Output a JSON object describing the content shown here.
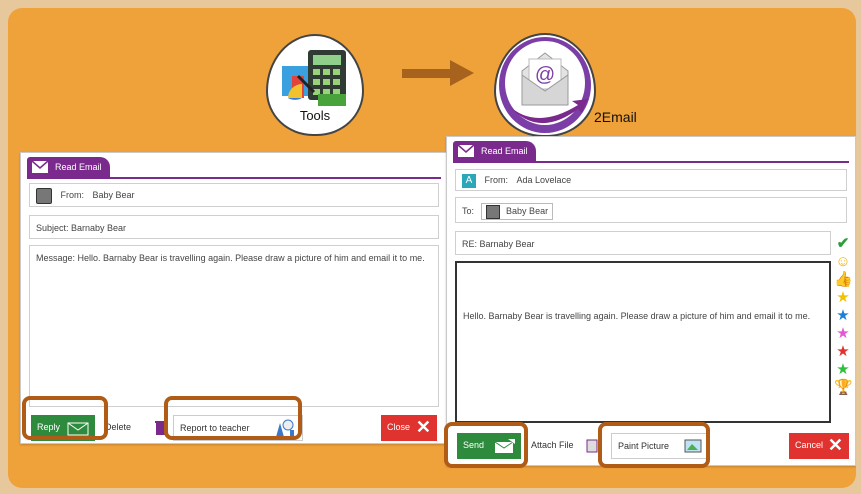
{
  "tools_icon": {
    "label": "Tools"
  },
  "email_icon": {
    "label": "2Email"
  },
  "read_panel": {
    "tab_label": "Read Email",
    "from_label": "From:",
    "from_name": "Baby Bear",
    "subject": "Subject:  Barnaby Bear",
    "message": "Message: Hello. Barnaby Bear is travelling again. Please draw a picture of him and email it to me.",
    "reply_label": "Reply",
    "delete_label": "Delete",
    "report_label": "Report to teacher",
    "close_label": "Close"
  },
  "compose_panel": {
    "tab_label": "Read Email",
    "avatar_letter": "A",
    "from_label": "From:",
    "from_name": "Ada Lovelace",
    "to_label": "To:",
    "to_name": "Baby Bear",
    "subject": "RE: Barnaby Bear",
    "body": "Hello. Barnaby Bear is travelling again. Please draw a picture of him and email it to me.",
    "send_label": "Send",
    "attach_label": "Attach File",
    "paint_label": "Paint Picture",
    "cancel_label": "Cancel"
  },
  "stickers": [
    "check",
    "smiley",
    "thumbs-up",
    "gold-star",
    "blue-star",
    "pink-star",
    "red-star",
    "green-star",
    "trophy"
  ],
  "colors": {
    "background": "#f0a23a",
    "tab": "#7a2a8c",
    "green_button": "#2e8b3e",
    "red_button": "#e0322e",
    "highlight": "#b05c16"
  }
}
